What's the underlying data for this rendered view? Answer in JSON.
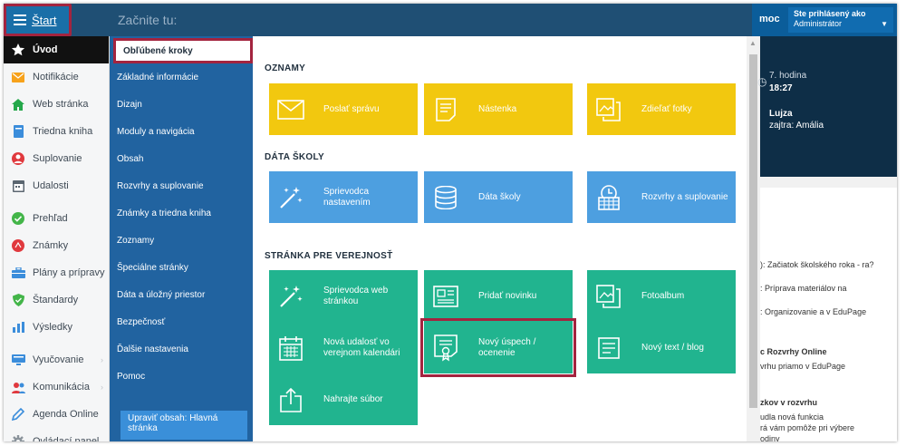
{
  "header": {
    "start_label": "Štart",
    "title": "Začnite tu:",
    "help_label": "moc",
    "login_title": "Ste prihlásený ako",
    "login_user": "Administrátor"
  },
  "sidebar": {
    "items": [
      {
        "label": "Úvod",
        "icon": "star-icon",
        "color": "#ffffff"
      },
      {
        "label": "Notifikácie",
        "icon": "envelope-icon",
        "color": "#f7a21b"
      },
      {
        "label": "Web stránka",
        "icon": "home-icon",
        "color": "#25a84b"
      },
      {
        "label": "Triedna kniha",
        "icon": "book-icon",
        "color": "#3b8ddb"
      },
      {
        "label": "Suplovanie",
        "icon": "substitute-icon",
        "color": "#e0393e"
      },
      {
        "label": "Udalosti",
        "icon": "calendar-icon",
        "color": "#5b6670"
      },
      {
        "label": "Prehľad",
        "icon": "check-circle-icon",
        "color": "#43b549"
      },
      {
        "label": "Známky",
        "icon": "grade-icon",
        "color": "#e0393e"
      },
      {
        "label": "Plány a prípravy",
        "icon": "briefcase-icon",
        "color": "#3b8ddb"
      },
      {
        "label": "Štandardy",
        "icon": "shield-icon",
        "color": "#43b549"
      },
      {
        "label": "Výsledky",
        "icon": "bar-chart-icon",
        "color": "#3b8ddb"
      },
      {
        "label": "Vyučovanie",
        "icon": "teaching-icon",
        "color": "#3b8ddb"
      },
      {
        "label": "Komunikácia",
        "icon": "people-icon",
        "color": "#e0393e"
      },
      {
        "label": "Agenda Online",
        "icon": "pencil-icon",
        "color": "#3b8ddb"
      },
      {
        "label": "Ovládací panel",
        "icon": "gear-icon",
        "color": "#8a939b"
      }
    ]
  },
  "menu": {
    "items": [
      "Obľúbené kroky",
      "Základné informácie",
      "Dizajn",
      "Moduly a navigácia",
      "Obsah",
      "Rozvrhy a suplovanie",
      "Známky a triedna kniha",
      "Zoznamy",
      "Špeciálne stránky",
      "Dáta a úložný priestor",
      "Bezpečnosť",
      "Ďalšie nastavenia",
      "Pomoc"
    ],
    "edit_line1": "Upraviť obsah: Hlavná",
    "edit_line2": "stránka"
  },
  "panel": {
    "sections": [
      {
        "title": "OZNAMY",
        "tiles": [
          {
            "label": "Poslať správu",
            "icon": "envelope-icon"
          },
          {
            "label": "Nástenka",
            "icon": "board-icon"
          },
          {
            "label": "Zdieľať fotky",
            "icon": "photos-icon"
          }
        ]
      },
      {
        "title": "DÁTA ŠKOLY",
        "tiles": [
          {
            "label": "Sprievodca nastavením",
            "icon": "magic-wand-icon"
          },
          {
            "label": "Dáta školy",
            "icon": "database-icon"
          },
          {
            "label": "Rozvrhy a suplovanie",
            "icon": "timetable-icon"
          }
        ]
      },
      {
        "title": "STRÁNKA PRE VEREJNOSŤ",
        "tiles": [
          {
            "label": "Sprievodca web stránkou",
            "icon": "magic-wand-icon"
          },
          {
            "label": "Pridať novinku",
            "icon": "news-icon"
          },
          {
            "label": "Fotoalbum",
            "icon": "photos-icon"
          },
          {
            "label": "Nová udalosť vo verejnom kalendári",
            "icon": "calendar-icon"
          },
          {
            "label": "Nový úspech / ocenenie",
            "icon": "award-icon"
          },
          {
            "label": "Nový text / blog",
            "icon": "text-icon"
          },
          {
            "label": "Nahrajte súbor",
            "icon": "upload-icon"
          }
        ]
      }
    ]
  },
  "dashboard": {
    "lesson": "7. hodina",
    "time": "18:27",
    "name": "Lujza",
    "tomorrow": "zajtra: Amália",
    "news": [
      "): Začiatok školského roka - ra?",
      ": Príprava materiálov na",
      ": Organizovanie a v EduPage",
      "c Rozvrhy Online",
      "vrhu priamo v EduPage",
      "zkov v rozvrhu",
      "udla nová funkcia",
      "rá vám pomôže pri výbere",
      "odiny"
    ]
  },
  "colors": {
    "header": "#1f4f74",
    "menu": "#2163a0",
    "tile_yellow": "#f2c80f",
    "tile_blue": "#4d9fe0",
    "tile_green": "#21b48f",
    "highlight": "#a3243f"
  }
}
